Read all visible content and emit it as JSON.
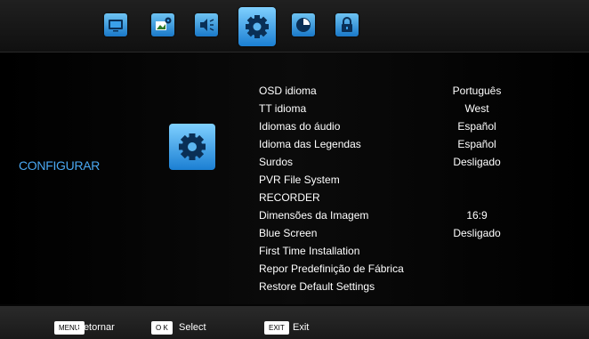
{
  "tabs": [
    {
      "icon": "tv-icon",
      "active": false
    },
    {
      "icon": "picture-settings-icon",
      "active": false
    },
    {
      "icon": "speaker-icon",
      "active": false
    },
    {
      "icon": "gear-icon",
      "active": true
    },
    {
      "icon": "clock-icon",
      "active": false
    },
    {
      "icon": "lock-icon",
      "active": false
    }
  ],
  "section": {
    "label": "CONFIGURAR",
    "icon": "gear-icon"
  },
  "menu": [
    {
      "label": "OSD idioma",
      "value": "Português"
    },
    {
      "label": "TT idioma",
      "value": "West"
    },
    {
      "label": "Idiomas do áudio",
      "value": "Español"
    },
    {
      "label": "Idioma das Legendas",
      "value": "Español"
    },
    {
      "label": "Surdos",
      "value": "Desligado"
    },
    {
      "label": "PVR File System",
      "value": ""
    },
    {
      "label": "RECORDER",
      "value": ""
    },
    {
      "label": "Dimensões da Imagem",
      "value": "16:9"
    },
    {
      "label": "Blue Screen",
      "value": "Desligado"
    },
    {
      "label": "First Time Installation",
      "value": ""
    },
    {
      "label": "Repor Predefinição de Fábrica",
      "value": ""
    },
    {
      "label": "Restore Default Settings",
      "value": ""
    }
  ],
  "footer": {
    "menu_key": "MENU",
    "menu_label": "Retornar",
    "ok_key": "O K",
    "ok_label": "Select",
    "exit_key": "EXIT",
    "exit_label": "Exit"
  },
  "colors": {
    "accent": "#1b7fd3",
    "section_label": "#4aa8f2"
  }
}
